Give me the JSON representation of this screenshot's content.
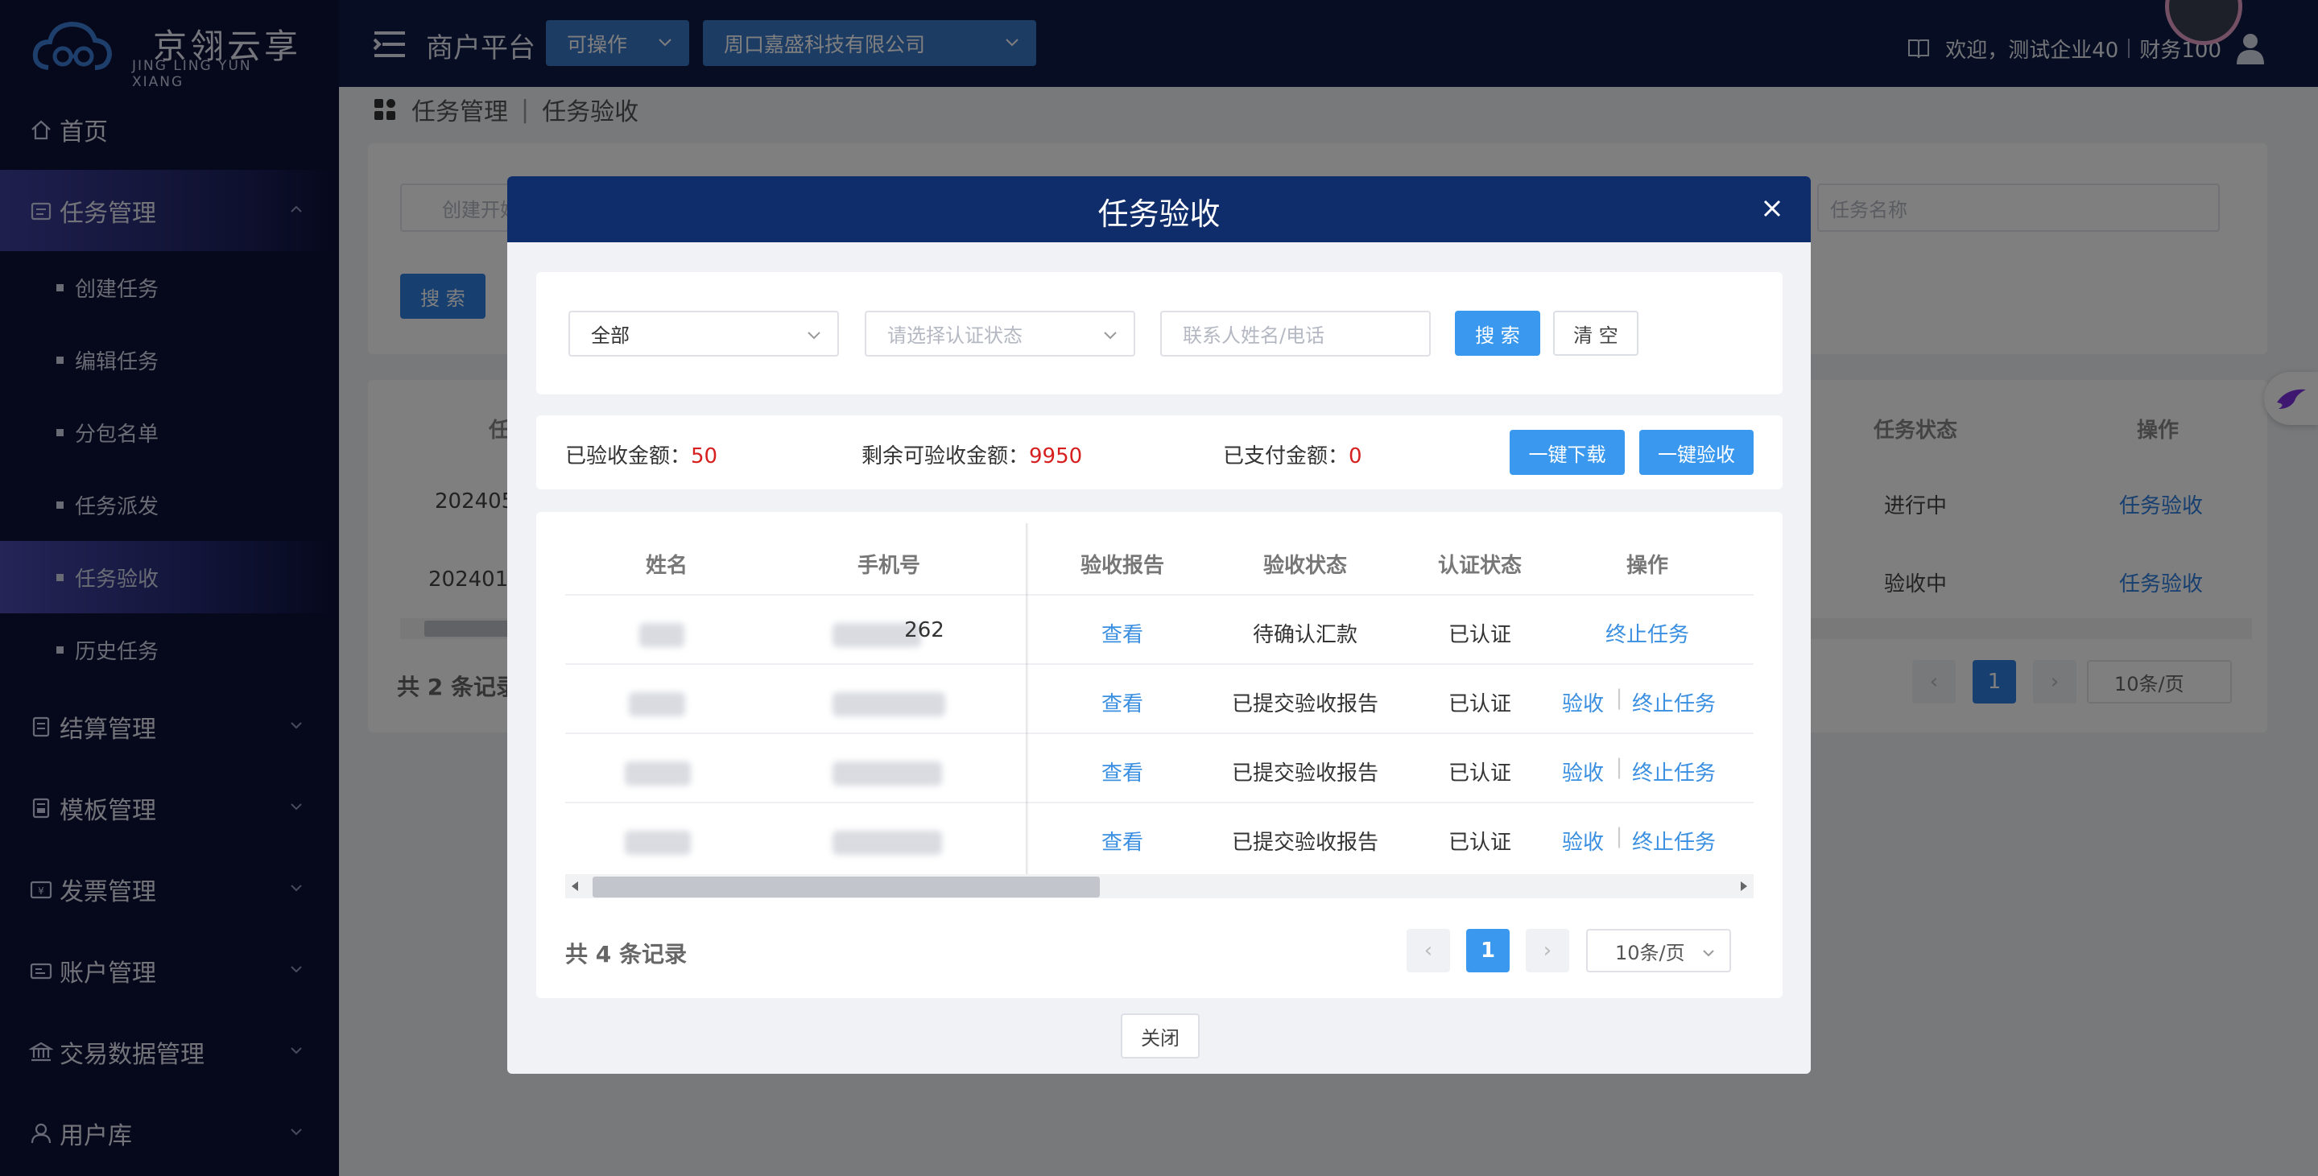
{
  "app": {
    "logo_cn": "京翎云享",
    "logo_en": "JING LING YUN XIANG",
    "platform": "商户平台",
    "operation_select": "可操作",
    "company_select": "周口嘉盛科技有限公司",
    "welcome": "欢迎，测试企业40",
    "user": "财务100"
  },
  "sidebar": {
    "home": "首页",
    "task_mgmt": "任务管理",
    "sub_items": [
      "创建任务",
      "编辑任务",
      "分包名单",
      "任务派发",
      "任务验收",
      "历史任务"
    ],
    "settlement": "结算管理",
    "template": "模板管理",
    "invoice": "发票管理",
    "account": "账户管理",
    "trade_data": "交易数据管理",
    "user_lib": "用户库"
  },
  "breadcrumb": {
    "root": "任务管理",
    "current": "任务验收"
  },
  "background": {
    "start_date_placeholder": "创建开始",
    "task_name_placeholder": "任务名称",
    "search_button": "搜 索",
    "col_task_prefix": "任",
    "col_task_status": "任务状态",
    "col_action": "操作",
    "rows": [
      {
        "id_prefix": "202405",
        "status": "进行中",
        "action": "任务验收"
      },
      {
        "id_prefix": "2024013",
        "status": "验收中",
        "action": "任务验收"
      }
    ],
    "total_prefix": "共 2 条记录",
    "page": "1",
    "page_size": "10条/页"
  },
  "modal": {
    "title": "任务验收",
    "filter": {
      "type_value": "全部",
      "auth_placeholder": "请选择认证状态",
      "contact_placeholder": "联系人姓名/电话",
      "search": "搜 索",
      "clear": "清 空"
    },
    "stats": {
      "accepted_label": "已验收金额：",
      "accepted_value": "50",
      "remaining_label": "剩余可验收金额：",
      "remaining_value": "9950",
      "paid_label": "已支付金额：",
      "paid_value": "0",
      "download_all": "一键下载",
      "accept_all": "一键验收"
    },
    "table": {
      "headers": [
        "姓名",
        "手机号",
        "验收报告",
        "验收状态",
        "认证状态",
        "操作"
      ],
      "rows": [
        {
          "report": "查看",
          "status": "待确认汇款",
          "auth": "已认证",
          "phone_tail": "262",
          "accept": "",
          "terminate": "终止任务"
        },
        {
          "report": "查看",
          "status": "已提交验收报告",
          "auth": "已认证",
          "phone_tail": "",
          "accept": "验收",
          "terminate": "终止任务"
        },
        {
          "report": "查看",
          "status": "已提交验收报告",
          "auth": "已认证",
          "phone_tail": "",
          "accept": "验收",
          "terminate": "终止任务"
        },
        {
          "report": "查看",
          "status": "已提交验收报告",
          "auth": "已认证",
          "phone_tail": "",
          "accept": "验收",
          "terminate": "终止任务"
        }
      ]
    },
    "pagination": {
      "total": "共 4 条记录",
      "page": "1",
      "page_size": "10条/页"
    },
    "close": "关闭"
  },
  "colors": {
    "primary": "#3a99ee",
    "nav_bg": "#0c1138",
    "modal_header": "#0f2d6b",
    "amount": "#d6201f"
  }
}
